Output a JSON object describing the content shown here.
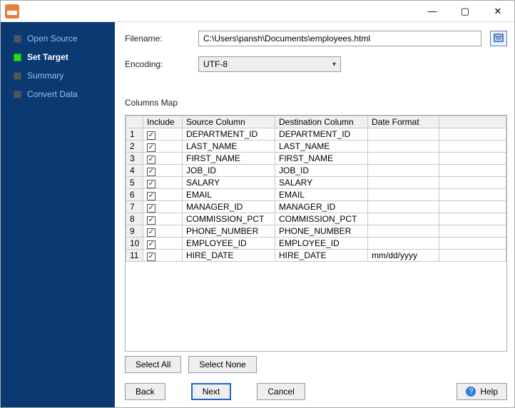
{
  "sidebar": {
    "items": [
      {
        "label": "Open Source",
        "active": false
      },
      {
        "label": "Set Target",
        "active": true
      },
      {
        "label": "Summary",
        "active": false
      },
      {
        "label": "Convert Data",
        "active": false
      }
    ]
  },
  "form": {
    "filename_label": "Filename:",
    "filename_value": "C:\\Users\\pansh\\Documents\\employees.html",
    "encoding_label": "Encoding:",
    "encoding_value": "UTF-8"
  },
  "columns_map": {
    "heading": "Columns Map",
    "headers": {
      "include": "Include",
      "source": "Source Column",
      "dest": "Destination Column",
      "format": "Date Format"
    },
    "rows": [
      {
        "n": "1",
        "inc": true,
        "src": "DEPARTMENT_ID",
        "dst": "DEPARTMENT_ID",
        "fmt": ""
      },
      {
        "n": "2",
        "inc": true,
        "src": "LAST_NAME",
        "dst": "LAST_NAME",
        "fmt": ""
      },
      {
        "n": "3",
        "inc": true,
        "src": "FIRST_NAME",
        "dst": "FIRST_NAME",
        "fmt": ""
      },
      {
        "n": "4",
        "inc": true,
        "src": "JOB_ID",
        "dst": "JOB_ID",
        "fmt": ""
      },
      {
        "n": "5",
        "inc": true,
        "src": "SALARY",
        "dst": "SALARY",
        "fmt": ""
      },
      {
        "n": "6",
        "inc": true,
        "src": "EMAIL",
        "dst": "EMAIL",
        "fmt": ""
      },
      {
        "n": "7",
        "inc": true,
        "src": "MANAGER_ID",
        "dst": "MANAGER_ID",
        "fmt": ""
      },
      {
        "n": "8",
        "inc": true,
        "src": "COMMISSION_PCT",
        "dst": "COMMISSION_PCT",
        "fmt": ""
      },
      {
        "n": "9",
        "inc": true,
        "src": "PHONE_NUMBER",
        "dst": "PHONE_NUMBER",
        "fmt": ""
      },
      {
        "n": "10",
        "inc": true,
        "src": "EMPLOYEE_ID",
        "dst": "EMPLOYEE_ID",
        "fmt": ""
      },
      {
        "n": "11",
        "inc": true,
        "src": "HIRE_DATE",
        "dst": "HIRE_DATE",
        "fmt": "mm/dd/yyyy"
      }
    ],
    "select_all": "Select All",
    "select_none": "Select None"
  },
  "buttons": {
    "back": "Back",
    "next": "Next",
    "cancel": "Cancel",
    "help": "Help"
  }
}
